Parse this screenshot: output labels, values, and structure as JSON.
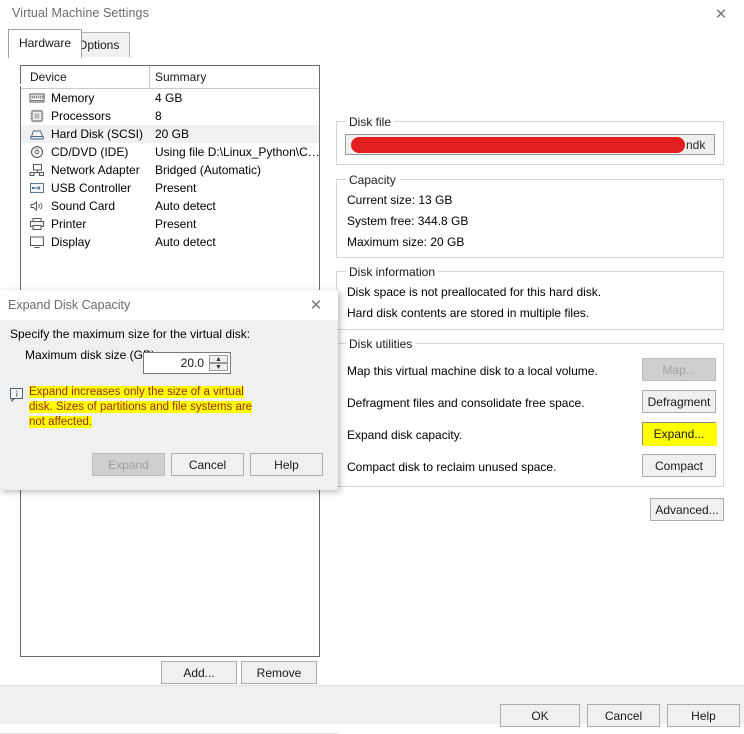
{
  "window": {
    "title": "Virtual Machine Settings",
    "close_icon": "close-icon"
  },
  "tabs": [
    {
      "label": "Hardware",
      "active": true
    },
    {
      "label": "Options",
      "active": false
    }
  ],
  "device_list": {
    "columns": [
      "Device",
      "Summary"
    ],
    "rows": [
      {
        "icon": "memory-icon",
        "name": "Memory",
        "summary": "4 GB",
        "selected": false
      },
      {
        "icon": "processor-icon",
        "name": "Processors",
        "summary": "8",
        "selected": false
      },
      {
        "icon": "hard-disk-icon",
        "name": "Hard Disk (SCSI)",
        "summary": "20 GB",
        "selected": true
      },
      {
        "icon": "optical-disc-icon",
        "name": "CD/DVD (IDE)",
        "summary": "Using file D:\\Linux_Python\\C…",
        "selected": false
      },
      {
        "icon": "network-adapter-icon",
        "name": "Network Adapter",
        "summary": "Bridged (Automatic)",
        "selected": false
      },
      {
        "icon": "usb-icon",
        "name": "USB Controller",
        "summary": "Present",
        "selected": false
      },
      {
        "icon": "speaker-icon",
        "name": "Sound Card",
        "summary": "Auto detect",
        "selected": false
      },
      {
        "icon": "printer-icon",
        "name": "Printer",
        "summary": "Present",
        "selected": false
      },
      {
        "icon": "display-icon",
        "name": "Display",
        "summary": "Auto detect",
        "selected": false
      }
    ],
    "add_label": "Add...",
    "remove_label": "Remove"
  },
  "disk_file": {
    "legend": "Disk file",
    "redacted": true,
    "visible_tail": "ndk"
  },
  "capacity": {
    "legend": "Capacity",
    "current_size": "Current size:  13 GB",
    "system_free": "System free:  344.8 GB",
    "maximum_size": "Maximum size:  20 GB"
  },
  "disk_information": {
    "legend": "Disk information",
    "line1": "Disk space is not preallocated for this hard disk.",
    "line2": "Hard disk contents are stored in multiple files."
  },
  "disk_utilities": {
    "legend": "Disk utilities",
    "rows": [
      {
        "label": "Map this virtual machine disk to a local volume.",
        "button": "Map...",
        "disabled": true,
        "highlighted": false
      },
      {
        "label": "Defragment files and consolidate free space.",
        "button": "Defragment",
        "disabled": false,
        "highlighted": false
      },
      {
        "label": "Expand disk capacity.",
        "button": "Expand...",
        "disabled": false,
        "highlighted": true
      },
      {
        "label": "Compact disk to reclaim unused space.",
        "button": "Compact",
        "disabled": false,
        "highlighted": false
      }
    ],
    "advanced_label": "Advanced..."
  },
  "footer": {
    "ok_label": "OK",
    "cancel_label": "Cancel",
    "help_label": "Help"
  },
  "dialog": {
    "title": "Expand Disk Capacity",
    "close_icon": "close-icon",
    "prompt": "Specify the maximum size for the virtual disk:",
    "field_label": "Maximum disk size (GB):",
    "field_value": "20.0",
    "spin_up_icon": "chevron-up-icon",
    "spin_down_icon": "chevron-down-icon",
    "note_icon": "info-icon",
    "note": "Expand increases only the size of a virtual disk. Sizes of partitions and file systems are not affected.",
    "expand_label": "Expand",
    "expand_disabled": true,
    "cancel_label": "Cancel",
    "help_label": "Help"
  },
  "colors": {
    "redaction_red": "#e21e1e",
    "highlight_yellow": "#ffff00",
    "note_text": "#9c2828",
    "window_chrome": "#f0f0f0",
    "selection": "#f0f0f0"
  }
}
